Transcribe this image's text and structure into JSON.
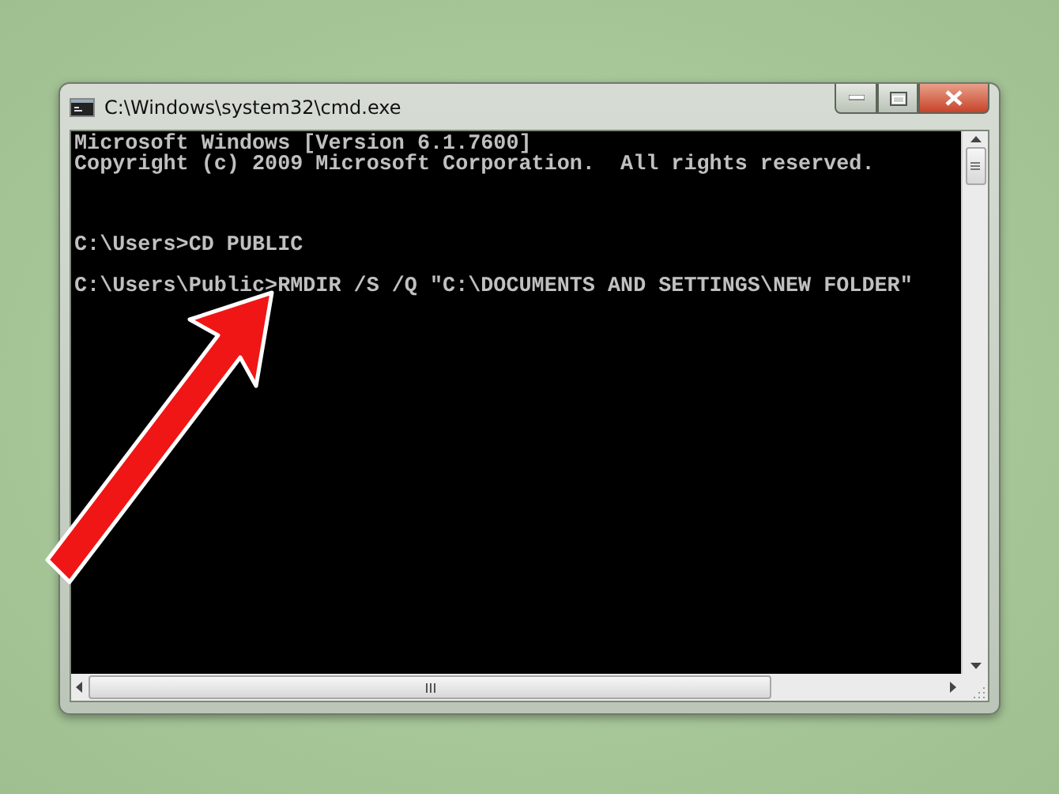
{
  "window": {
    "title": "C:\\Windows\\system32\\cmd.exe"
  },
  "console": {
    "banner": [
      "Microsoft Windows [Version 6.1.7600]",
      "Copyright (c) 2009 Microsoft Corporation.  All rights reserved."
    ],
    "commands": [
      "C:\\Users>CD PUBLIC",
      "C:\\Users\\Public>RMDIR /S /Q \"C:\\DOCUMENTS AND SETTINGS\\NEW FOLDER\""
    ]
  }
}
